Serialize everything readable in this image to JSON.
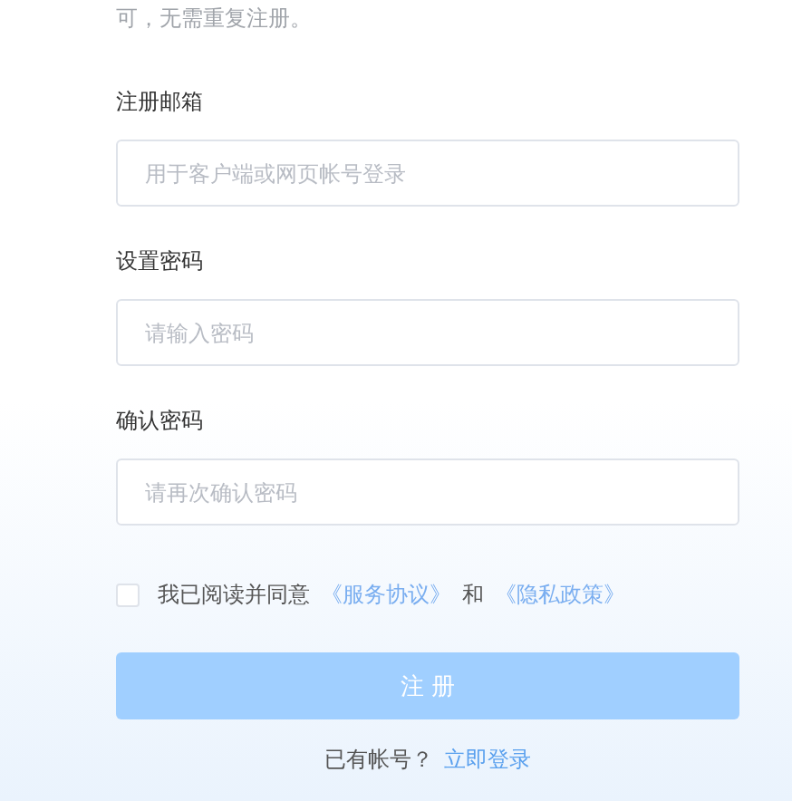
{
  "notice": "可，无需重复注册。",
  "fields": [
    {
      "label": "注册邮箱",
      "placeholder": "用于客户端或网页帐号登录"
    },
    {
      "label": "设置密码",
      "placeholder": "请输入密码"
    },
    {
      "label": "确认密码",
      "placeholder": "请再次确认密码"
    }
  ],
  "agreement": {
    "checked": false,
    "text": "我已阅读并同意",
    "link_1": "《服务协议》",
    "joiner": "和",
    "link_2": "《隐私政策》"
  },
  "submit": {
    "label": "注 册",
    "disabled": true
  },
  "login": {
    "prompt": "已有帐号？",
    "link": "立即登录"
  }
}
